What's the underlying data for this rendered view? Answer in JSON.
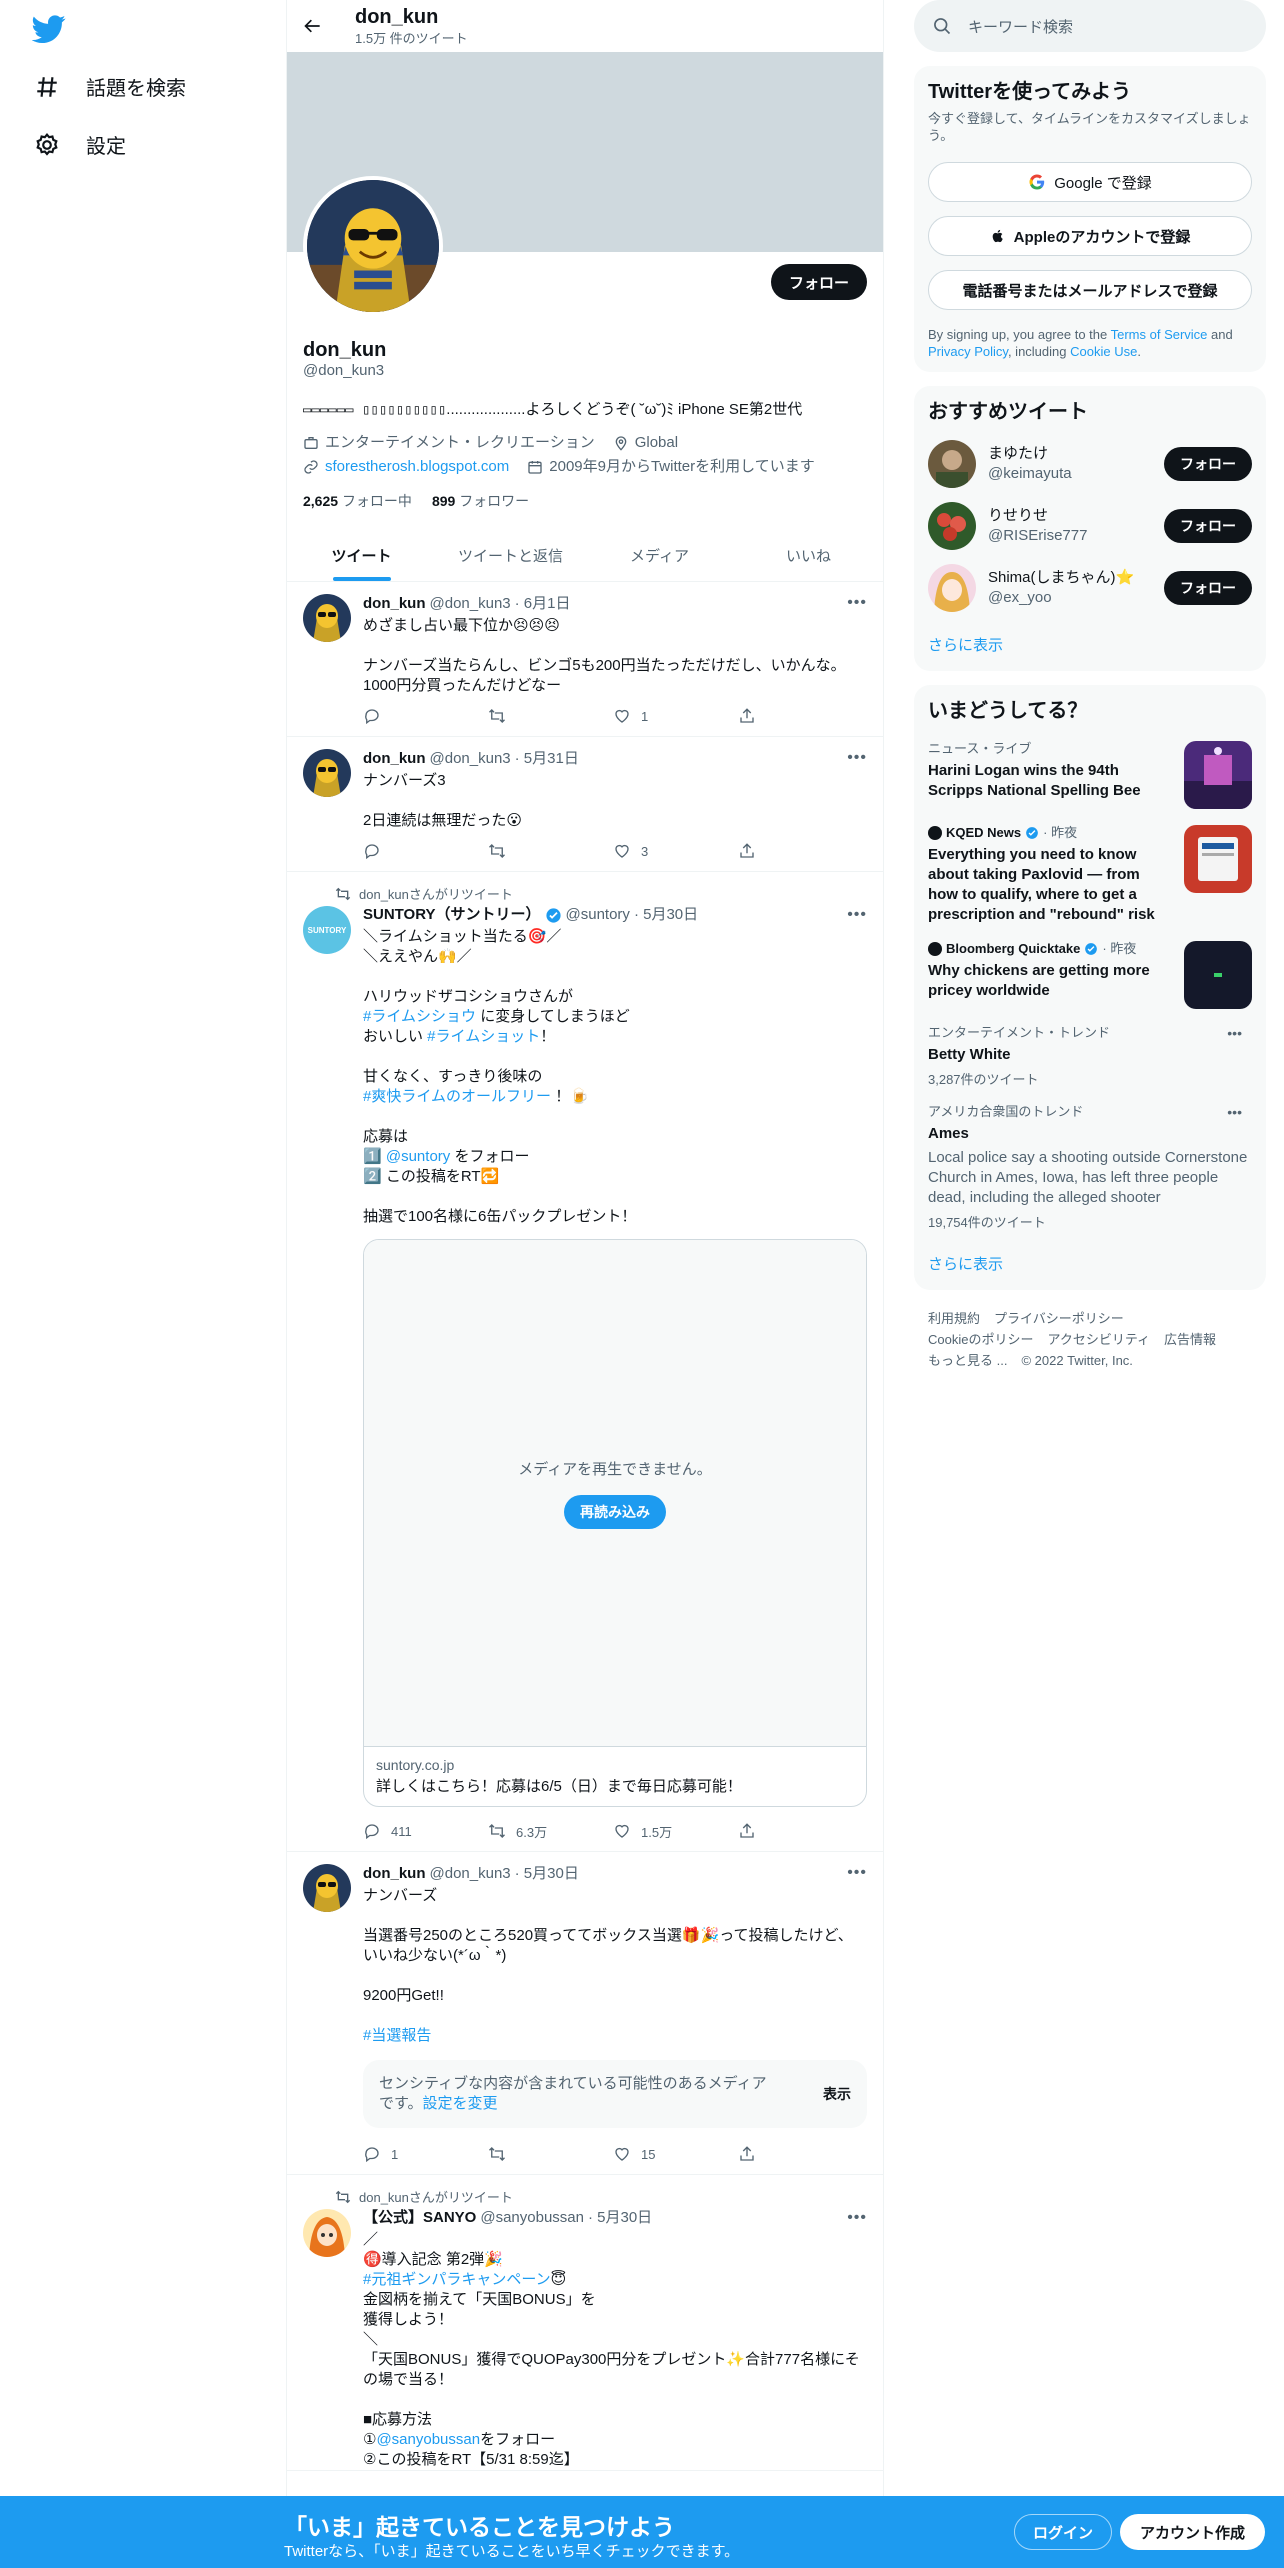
{
  "nav": {
    "explore_label": "話題を検索",
    "settings_label": "設定"
  },
  "header": {
    "title": "don_kun",
    "tweet_count": "1.5万 件のツイート"
  },
  "profile": {
    "follow_label": "フォロー",
    "name": "don_kun",
    "handle": "@don_kun3",
    "bio_art": "▭▭▭▭▭▭ ▯▯▯▯▯▯▯▯▯▯",
    "bio_text": "...................よろしくどうぞ( ˘ω˘)ﾐ iPhone SE第2世代",
    "category": "エンターテイメント・レクリエーション",
    "location": "Global",
    "website": "sforestherosh.blogspot.com",
    "joined": "2009年9月からTwitterを利用しています",
    "following_count": "2,625",
    "following_label": "フォロー中",
    "followers_count": "899",
    "followers_label": "フォロワー"
  },
  "tabs": [
    "ツイート",
    "ツイートと返信",
    "メディア",
    "いいね"
  ],
  "tweets": [
    {
      "name": "don_kun",
      "handle": "@don_kun3",
      "date": "· 6月1日",
      "text": "めざまし占い最下位か😣😣😣\n\nナンバーズ当たらんし、ビンゴ5も200円当たっただけだし、いかんな。\n1000円分買ったんだけどなー",
      "replies": "",
      "retweets": "",
      "likes": "1"
    },
    {
      "name": "don_kun",
      "handle": "@don_kun3",
      "date": "· 5月31日",
      "text": "ナンバーズ3\n\n2日連続は無理だった😮",
      "replies": "",
      "retweets": "",
      "likes": "3"
    },
    {
      "retweet_by": "don_kunさんがリツイート",
      "name": "SUNTORY（サントリー）",
      "handle": "@suntory",
      "date": "· 5月30日",
      "avatar_text": "SUNTORY",
      "text_1": "＼ライムショット当たる🎯／\n＼ええやん🙌／\n\nハリウッドザコシショウさんが\n",
      "tag_1": "#ライムシショウ",
      "text_2": " に変身してしまうほど\nおいしい ",
      "tag_2": "#ライムショット",
      "text_3": "！\n\n甘くなく、すっきり後味の\n",
      "tag_3": "#爽快ライムのオールフリー",
      "text_4": " ！🍺\n\n応募は\n1️⃣ ",
      "mention": "@suntory",
      "text_5": " をフォロー\n2️⃣ この投稿をRT🔁\n\n抽選で100名様に6缶パックプレゼント！",
      "media_msg": "メディアを再生できません。",
      "reload_label": "再読み込み",
      "card_domain": "suntory.co.jp",
      "card_desc": "詳しくはこちら！応募は6/5（日）まで毎日応募可能！",
      "replies": "411",
      "retweets": "6.3万",
      "likes": "1.5万"
    },
    {
      "name": "don_kun",
      "handle": "@don_kun3",
      "date": "· 5月30日",
      "text": "ナンバーズ\n\n当選番号250のところ520買っててボックス当選🎁🎉って投稿したけど、いいね少ない(*´ω｀*)\n\n9200円Get!!\n\n",
      "tag": "#当選報告",
      "sensitive_text": "センシティブな内容が含まれている可能性のあるメディアです。",
      "sensitive_link": "設定を変更",
      "show_label": "表示",
      "replies": "1",
      "retweets": "",
      "likes": "15"
    },
    {
      "retweet_by": "don_kunさんがリツイート",
      "name": "【公式】SANYO",
      "handle": "@sanyobussan",
      "date": "· 5月30日",
      "text_1": "／\n🉐導入記念 第2弾🎉\n",
      "tag_1": "#元祖ギンパラキャンペーン",
      "text_2": "😇\n金図柄を揃えて「天国BONUS」を\n獲得しよう！\n＼\n「天国BONUS」獲得でQUOPay300円分をプレゼント✨合計777名様にその場で当る！\n\n■応募方法\n①",
      "mention": "@sanyobussan",
      "text_3": "をフォロー\n②この投稿をRT【5/31 8:59迄】"
    }
  ],
  "right": {
    "search_placeholder": "キーワード検索",
    "signup_title": "Twitterを使ってみよう",
    "signup_sub": "今すぐ登録して、タイムラインをカスタマイズしましょう。",
    "google_label": "Google で登録",
    "apple_label": "Appleのアカウントで登録",
    "phone_label": "電話番号またはメールアドレスで登録",
    "legal_1": "By signing up, you agree to the ",
    "tos": "Terms of Service",
    "legal_2": " and ",
    "privacy": "Privacy Policy",
    "legal_3": ", including ",
    "cookie": "Cookie Use",
    "legal_4": ".",
    "who_title": "おすすめツイート",
    "who": [
      {
        "name": "まゆたけ",
        "handle": "@keimayuta",
        "btn": "フォロー"
      },
      {
        "name": "りせりせ",
        "handle": "@RISErise777",
        "btn": "フォロー"
      },
      {
        "name": "Shima(しまちゃん)⭐",
        "handle": "@ex_yoo",
        "btn": "フォロー"
      }
    ],
    "who_more": "さらに表示",
    "trends_title": "いまどうしてる？",
    "trends": [
      {
        "cat": "ニュース・ライブ",
        "title": "Harini Logan wins the 94th Scripps National Spelling Bee"
      },
      {
        "cat": "KQED News",
        "cat2": "· 昨夜",
        "title": "Everything you need to know about taking Paxlovid — from how to qualify, where to get a prescription and \"rebound\" risk"
      },
      {
        "cat": "Bloomberg Quicktake",
        "cat2": "· 昨夜",
        "title": "Why chickens are getting more pricey worldwide"
      },
      {
        "cat": "エンターテイメント・トレンド",
        "title": "Betty White",
        "count": "3,287件のツイート"
      },
      {
        "cat": "アメリカ合衆国のトレンド",
        "title": "Ames",
        "desc": "Local police say a shooting outside Cornerstone Church in Ames, Iowa, has left three people dead, including the alleged shooter",
        "count": "19,754件のツイート"
      }
    ],
    "trends_more": "さらに表示",
    "footer": {
      "terms": "利用規約",
      "privacy": "プライバシーポリシー",
      "cookie": "Cookieのポリシー",
      "access": "アクセシビリティ",
      "ads": "広告情報",
      "more": "もっと見る ...",
      "copy": "© 2022 Twitter, Inc."
    }
  },
  "bottom": {
    "title": "「いま」起きていることを見つけよう",
    "sub": "Twitterなら、「いま」起きていることをいち早くチェックできます。",
    "login": "ログイン",
    "signup": "アカウント作成"
  },
  "colors": {
    "accent": "#1d9bf0",
    "text": "#0f1419",
    "muted": "#536471"
  }
}
